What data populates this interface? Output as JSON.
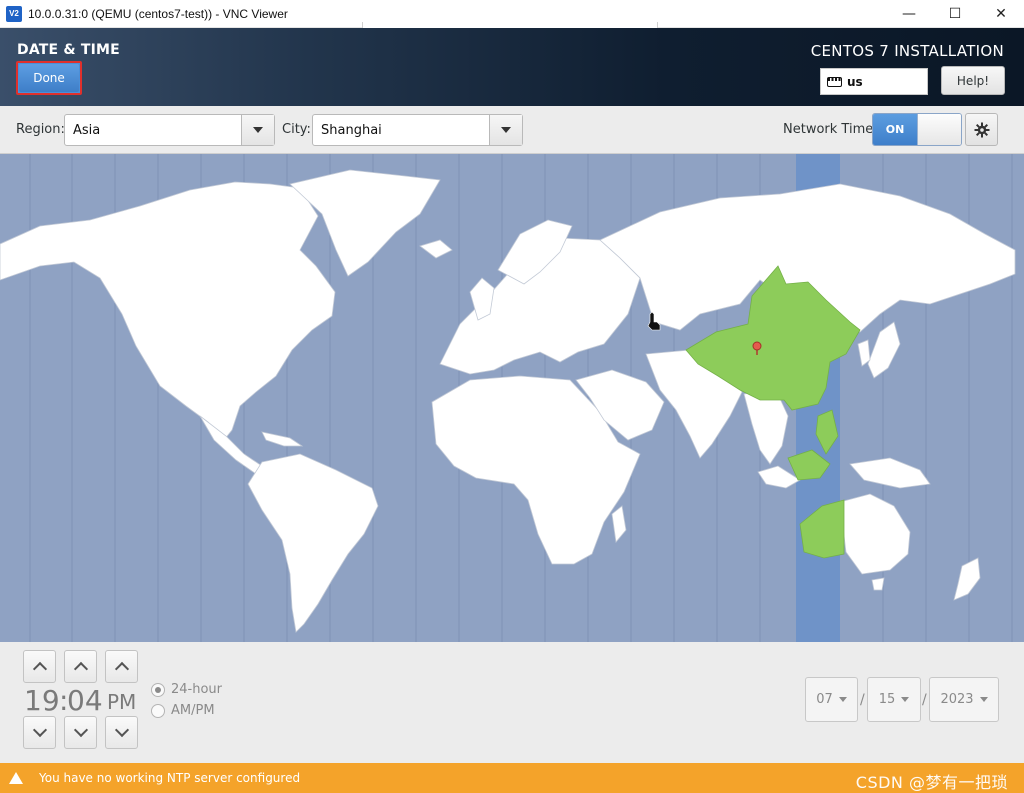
{
  "window": {
    "title": "10.0.0.31:0 (QEMU (centos7-test)) - VNC Viewer",
    "icon_label": "V2",
    "controls": {
      "minimize": "—",
      "maximize": "☐",
      "close": "✕"
    }
  },
  "header": {
    "page_title": "DATE & TIME",
    "done_label": "Done",
    "install_title": "CENTOS 7 INSTALLATION",
    "keyboard_layout": "us",
    "help_label": "Help!"
  },
  "toolbar": {
    "region_label": "Region:",
    "region_value": "Asia",
    "city_label": "City:",
    "city_value": "Shanghai",
    "network_time_label": "Network Time",
    "network_time_state": "ON"
  },
  "time": {
    "hours": "19",
    "separator": ":",
    "minutes": "04",
    "period": "PM",
    "format_24": "24-hour",
    "format_ampm": "AM/PM",
    "selected_format": "24-hour"
  },
  "date": {
    "month": "07",
    "day": "15",
    "year": "2023",
    "separator": "/"
  },
  "status": {
    "warning": "You have no working NTP server configured",
    "watermark": "CSDN @梦有一把琐"
  },
  "colors": {
    "ocean": "#8fa2c3",
    "land": "#ffffff",
    "selected_timezone": "#8dcc5a",
    "timezone_band": "#6f93c8",
    "accent": "#3e7fca",
    "warning": "#f4a32a"
  }
}
